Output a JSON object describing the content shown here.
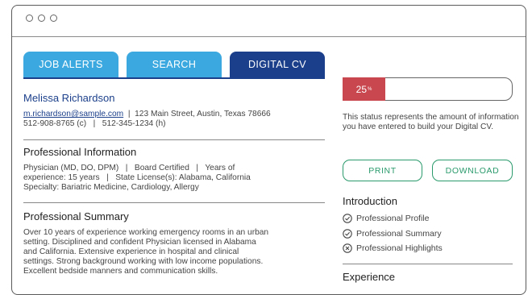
{
  "tabs": [
    {
      "label": "JOB ALERTS"
    },
    {
      "label": "SEARCH"
    },
    {
      "label": "DIGITAL CV"
    }
  ],
  "profile": {
    "name": "Melissa Richardson",
    "email": "m.richardson@sample.com",
    "address_sep": "|",
    "address": "123 Main Street, Austin, Texas 78666",
    "phones": "512-908-8765 (c)   |   512-345-1234 (h)"
  },
  "professional_information": {
    "heading": "Professional Information",
    "lines": [
      "Physician (MD, DO, DPM)   |   Board Certified   |   Years of",
      "experience: 15 years   |   State License(s): Alabama, California",
      "Specialty: Bariatric Medicine, Cardiology, Allergy"
    ]
  },
  "professional_summary": {
    "heading": "Professional Summary",
    "lines": [
      "Over 10 years of experience working emergency rooms in an urban",
      "setting. Disciplined and confident Physician licensed in Alabama",
      "and California. Extensive experience in hospital and clinical",
      "settings. Strong background working with low income populations.",
      "Excellent bedside manners and communication skills."
    ]
  },
  "progress": {
    "value": 25,
    "label": "25",
    "unit": "%"
  },
  "status_text": "This status represents the amount of information you have entered to build your Digital CV.",
  "buttons": {
    "print": "PRINT",
    "download": "DOWNLOAD"
  },
  "introduction": {
    "heading": "Introduction",
    "items": [
      {
        "label": "Professional Profile",
        "status": "complete",
        "icon": "check-circle-icon"
      },
      {
        "label": "Professional Summary",
        "status": "complete",
        "icon": "check-circle-icon"
      },
      {
        "label": "Professional Highlights",
        "status": "incomplete",
        "icon": "x-circle-icon"
      }
    ]
  },
  "experience": {
    "heading": "Experience"
  },
  "colors": {
    "tab_light": "#3ba9df",
    "tab_active": "#1b3f8a",
    "progress_fill": "#c9484f",
    "button_outline": "#2a9a6c",
    "name_link": "#1b3f8a"
  }
}
